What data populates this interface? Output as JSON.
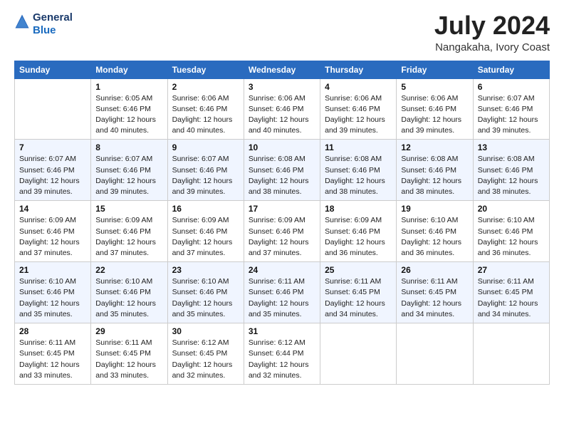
{
  "header": {
    "logo": {
      "line1": "General",
      "line2": "Blue"
    },
    "title": "July 2024",
    "location": "Nangakaha, Ivory Coast"
  },
  "calendar": {
    "days_of_week": [
      "Sunday",
      "Monday",
      "Tuesday",
      "Wednesday",
      "Thursday",
      "Friday",
      "Saturday"
    ],
    "weeks": [
      [
        {
          "day": "",
          "info": ""
        },
        {
          "day": "1",
          "info": "Sunrise: 6:05 AM\nSunset: 6:46 PM\nDaylight: 12 hours\nand 40 minutes."
        },
        {
          "day": "2",
          "info": "Sunrise: 6:06 AM\nSunset: 6:46 PM\nDaylight: 12 hours\nand 40 minutes."
        },
        {
          "day": "3",
          "info": "Sunrise: 6:06 AM\nSunset: 6:46 PM\nDaylight: 12 hours\nand 40 minutes."
        },
        {
          "day": "4",
          "info": "Sunrise: 6:06 AM\nSunset: 6:46 PM\nDaylight: 12 hours\nand 39 minutes."
        },
        {
          "day": "5",
          "info": "Sunrise: 6:06 AM\nSunset: 6:46 PM\nDaylight: 12 hours\nand 39 minutes."
        },
        {
          "day": "6",
          "info": "Sunrise: 6:07 AM\nSunset: 6:46 PM\nDaylight: 12 hours\nand 39 minutes."
        }
      ],
      [
        {
          "day": "7",
          "info": "Sunrise: 6:07 AM\nSunset: 6:46 PM\nDaylight: 12 hours\nand 39 minutes."
        },
        {
          "day": "8",
          "info": "Sunrise: 6:07 AM\nSunset: 6:46 PM\nDaylight: 12 hours\nand 39 minutes."
        },
        {
          "day": "9",
          "info": "Sunrise: 6:07 AM\nSunset: 6:46 PM\nDaylight: 12 hours\nand 39 minutes."
        },
        {
          "day": "10",
          "info": "Sunrise: 6:08 AM\nSunset: 6:46 PM\nDaylight: 12 hours\nand 38 minutes."
        },
        {
          "day": "11",
          "info": "Sunrise: 6:08 AM\nSunset: 6:46 PM\nDaylight: 12 hours\nand 38 minutes."
        },
        {
          "day": "12",
          "info": "Sunrise: 6:08 AM\nSunset: 6:46 PM\nDaylight: 12 hours\nand 38 minutes."
        },
        {
          "day": "13",
          "info": "Sunrise: 6:08 AM\nSunset: 6:46 PM\nDaylight: 12 hours\nand 38 minutes."
        }
      ],
      [
        {
          "day": "14",
          "info": "Sunrise: 6:09 AM\nSunset: 6:46 PM\nDaylight: 12 hours\nand 37 minutes."
        },
        {
          "day": "15",
          "info": "Sunrise: 6:09 AM\nSunset: 6:46 PM\nDaylight: 12 hours\nand 37 minutes."
        },
        {
          "day": "16",
          "info": "Sunrise: 6:09 AM\nSunset: 6:46 PM\nDaylight: 12 hours\nand 37 minutes."
        },
        {
          "day": "17",
          "info": "Sunrise: 6:09 AM\nSunset: 6:46 PM\nDaylight: 12 hours\nand 37 minutes."
        },
        {
          "day": "18",
          "info": "Sunrise: 6:09 AM\nSunset: 6:46 PM\nDaylight: 12 hours\nand 36 minutes."
        },
        {
          "day": "19",
          "info": "Sunrise: 6:10 AM\nSunset: 6:46 PM\nDaylight: 12 hours\nand 36 minutes."
        },
        {
          "day": "20",
          "info": "Sunrise: 6:10 AM\nSunset: 6:46 PM\nDaylight: 12 hours\nand 36 minutes."
        }
      ],
      [
        {
          "day": "21",
          "info": "Sunrise: 6:10 AM\nSunset: 6:46 PM\nDaylight: 12 hours\nand 35 minutes."
        },
        {
          "day": "22",
          "info": "Sunrise: 6:10 AM\nSunset: 6:46 PM\nDaylight: 12 hours\nand 35 minutes."
        },
        {
          "day": "23",
          "info": "Sunrise: 6:10 AM\nSunset: 6:46 PM\nDaylight: 12 hours\nand 35 minutes."
        },
        {
          "day": "24",
          "info": "Sunrise: 6:11 AM\nSunset: 6:46 PM\nDaylight: 12 hours\nand 35 minutes."
        },
        {
          "day": "25",
          "info": "Sunrise: 6:11 AM\nSunset: 6:45 PM\nDaylight: 12 hours\nand 34 minutes."
        },
        {
          "day": "26",
          "info": "Sunrise: 6:11 AM\nSunset: 6:45 PM\nDaylight: 12 hours\nand 34 minutes."
        },
        {
          "day": "27",
          "info": "Sunrise: 6:11 AM\nSunset: 6:45 PM\nDaylight: 12 hours\nand 34 minutes."
        }
      ],
      [
        {
          "day": "28",
          "info": "Sunrise: 6:11 AM\nSunset: 6:45 PM\nDaylight: 12 hours\nand 33 minutes."
        },
        {
          "day": "29",
          "info": "Sunrise: 6:11 AM\nSunset: 6:45 PM\nDaylight: 12 hours\nand 33 minutes."
        },
        {
          "day": "30",
          "info": "Sunrise: 6:12 AM\nSunset: 6:45 PM\nDaylight: 12 hours\nand 32 minutes."
        },
        {
          "day": "31",
          "info": "Sunrise: 6:12 AM\nSunset: 6:44 PM\nDaylight: 12 hours\nand 32 minutes."
        },
        {
          "day": "",
          "info": ""
        },
        {
          "day": "",
          "info": ""
        },
        {
          "day": "",
          "info": ""
        }
      ]
    ]
  }
}
